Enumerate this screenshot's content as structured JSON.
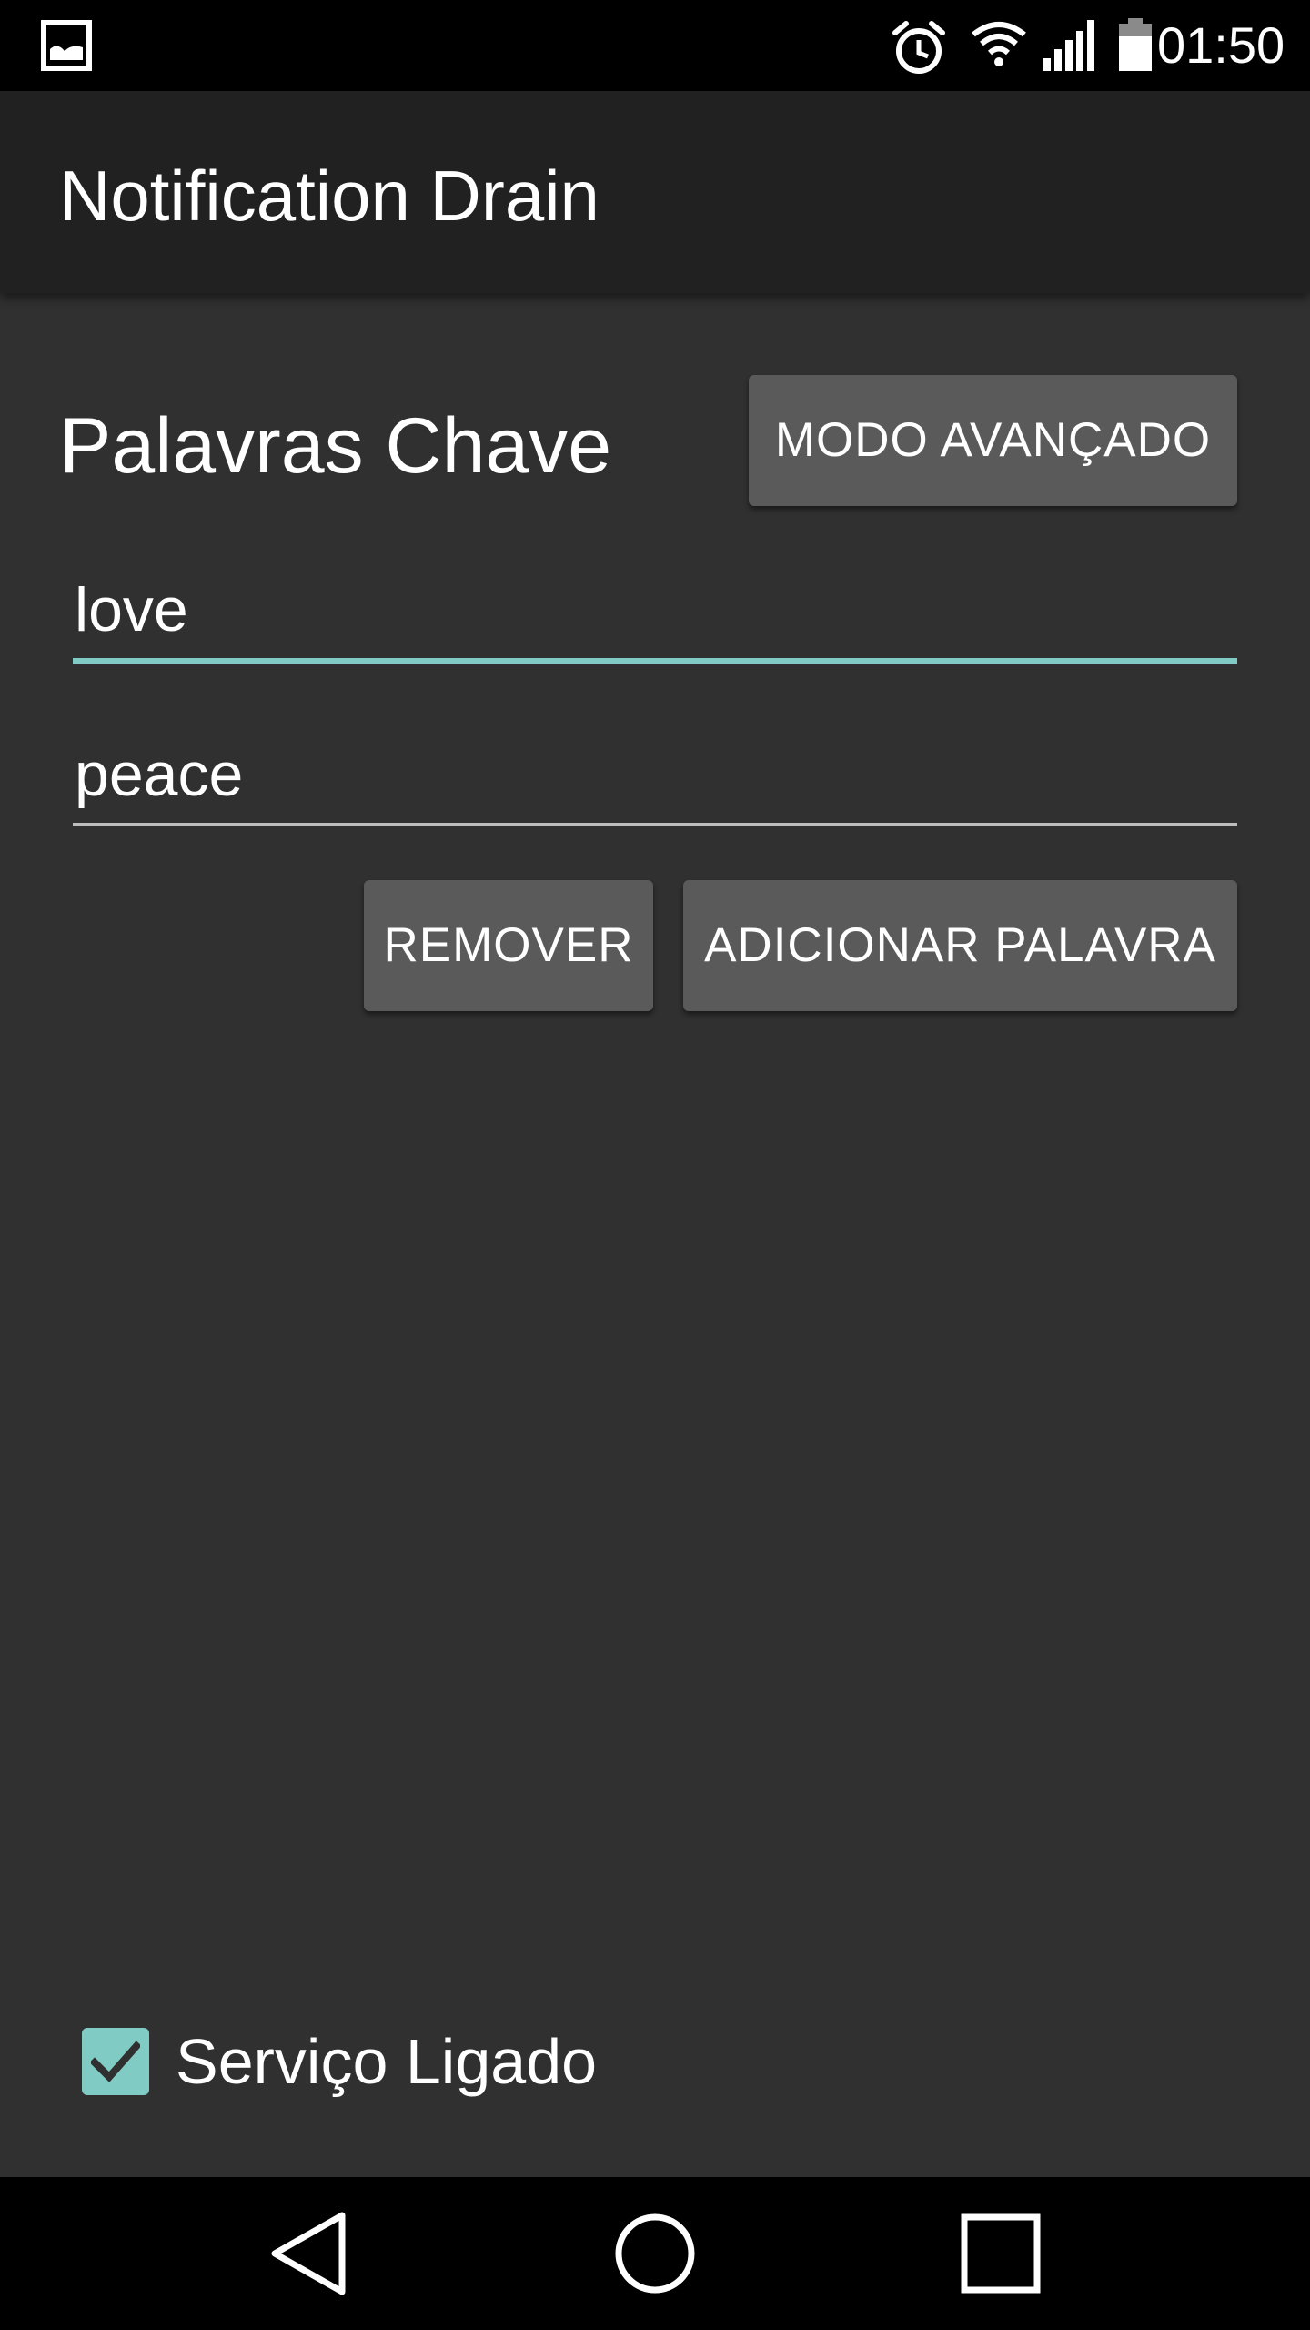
{
  "status_bar": {
    "time": "01:50",
    "icons": [
      "gallery-icon",
      "alarm-icon",
      "wifi-icon",
      "signal-icon",
      "battery-icon"
    ]
  },
  "toolbar": {
    "title": "Notification Drain"
  },
  "main": {
    "section_title": "Palavras Chave",
    "advanced_button_label": "MODO AVANÇADO",
    "keywords": [
      {
        "value": "love",
        "focused": true
      },
      {
        "value": "peace",
        "focused": false
      }
    ],
    "remove_button_label": "REMOVER",
    "add_button_label": "ADICIONAR PALAVRA"
  },
  "service": {
    "label": "Serviço Ligado",
    "checked": true
  },
  "nav_bar": {
    "icons": [
      "back-icon",
      "home-icon",
      "recents-icon"
    ]
  },
  "colors": {
    "background": "#303030",
    "toolbar": "#212121",
    "accent": "#80cbc4",
    "button": "#5a5a5a"
  }
}
